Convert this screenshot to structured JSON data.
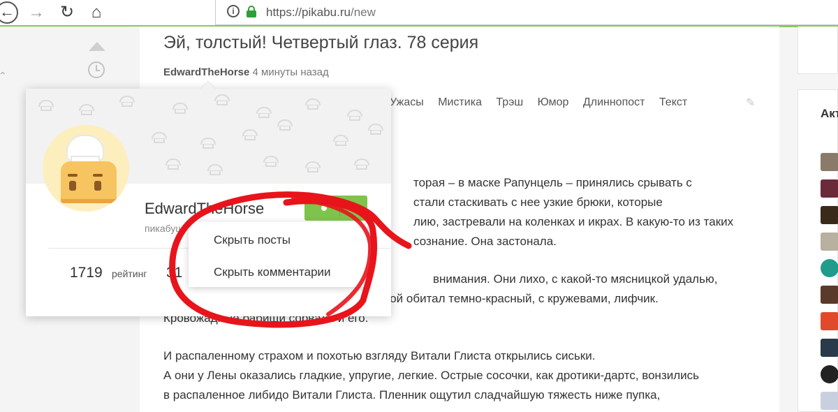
{
  "browser": {
    "url_host": "https://pikabu.ru",
    "url_path": "/new",
    "back_glyph": "←",
    "forward_glyph": "→",
    "reload_glyph": "↻",
    "home_glyph": "⌂",
    "info_glyph": "i",
    "icons": [
      "back-icon",
      "forward-icon",
      "reload-icon",
      "home-icon",
      "info-icon",
      "lock-icon"
    ],
    "accent_color": "#8ac858"
  },
  "post": {
    "title": "Эй, толстый! Четвертый глаз. 78 серия",
    "author": "EdwardTheHorse",
    "time_ago": "4 минуты назад",
    "tags": [
      "Ужасы",
      "Мистика",
      "Трэш",
      "Юмор",
      "Длиннопост",
      "Текст"
    ],
    "edit_glyph": "✎",
    "paragraphs": [
      "торая – в маске Рапунцель – принялись срывать с",
      "стали стаскивать с нее узкие брюки, которые",
      "лию, застревали на коленках и икрах. В какую-то из таких",
      "сознание. Она застонала.",
      "",
      "внимания. Они лихо, с какой-то мясницкой удалью,",
      "сдернули с Лены футболку. Под футболкой обитал темно-красный, с кружевами, лифчик.",
      "Кровожадные бабищи сорвали и его.",
      "",
      "И распаленному страхом и похотью взгляду Витали Глиста открылись сиськи.",
      "А они у Лены оказались гладкие, упругие, легкие. Острые сосочки, как дротики-дартс, вонзились",
      "в распаленное либидо Витали Глиста. Пленник ощутил сладчайшую тяжесть ниже пупка,"
    ]
  },
  "profile_card": {
    "name": "EdwardTheHorse",
    "subtitle": "пикабуш",
    "rating_value": "1719",
    "rating_label": "рейтинг",
    "second_stat_value": "31",
    "more_glyph": "···",
    "button_color": "#7ec34b"
  },
  "dropdown": {
    "items": [
      "Скрыть посты",
      "Скрыть комментарии"
    ]
  },
  "sidebar_right": {
    "title_fragment": "Акт"
  },
  "annotation": {
    "color": "#e8141b"
  }
}
